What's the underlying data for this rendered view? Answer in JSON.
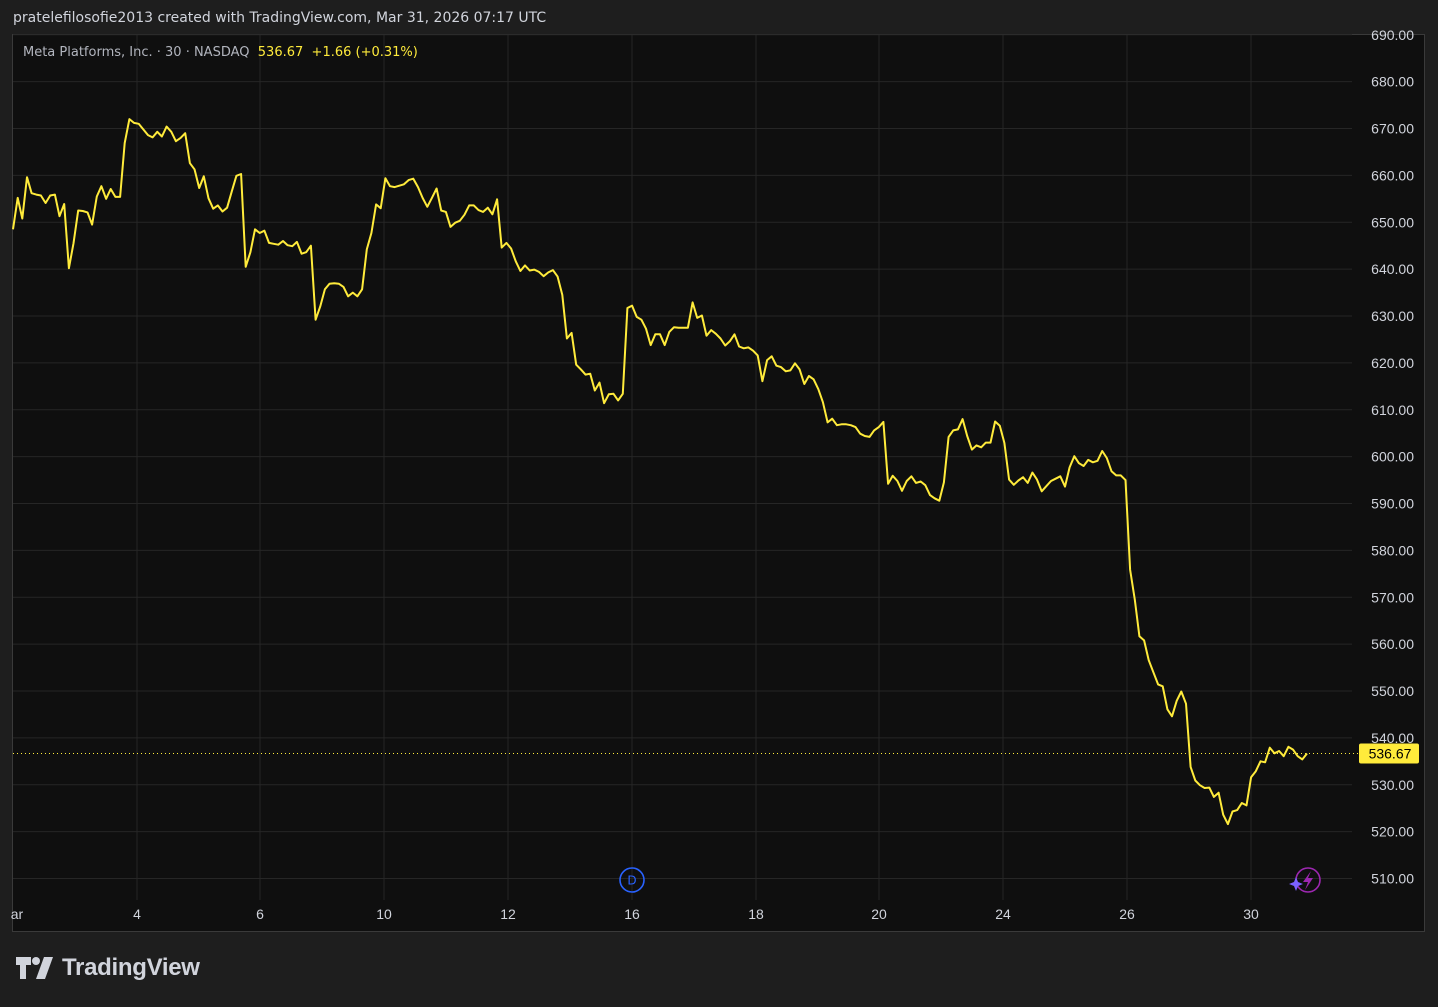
{
  "header": {
    "attribution": "pratelefilosofie2013 created with TradingView.com, Mar 31, 2026 07:17 UTC"
  },
  "legend": {
    "symbol": "Meta Platforms, Inc. · 30 · NASDAQ",
    "last": "536.67",
    "change": "+1.66 (+0.31%)"
  },
  "brand": {
    "name": "TradingView",
    "icon": "tradingview-logo-icon"
  },
  "markers": {
    "dividend": "D",
    "lightning": "lightning-icon"
  },
  "colors": {
    "line": "#ffeb3b",
    "background": "#0f0f0f",
    "grid": "#262626",
    "axis_text": "#d1d4dc",
    "price_tag_bg": "#ffeb3b",
    "dividend_marker": "#2962ff",
    "lightning_marker": "#9c27b0"
  },
  "chart_data": {
    "type": "line",
    "title": "Meta Platforms, Inc. · 30 · NASDAQ",
    "series": [
      {
        "name": "Meta Platforms, Inc.",
        "values": [
          648.5,
          655.2,
          650.8,
          659.6,
          656.2,
          655.9,
          655.7,
          654.1,
          655.7,
          655.9,
          651.3,
          653.9,
          640.2,
          645.5,
          652.5,
          652.4,
          652.1,
          649.5,
          655.5,
          657.7,
          655.0,
          657.1,
          655.4,
          655.4,
          666.9,
          672.0,
          671.2,
          671.0,
          669.8,
          668.6,
          668.1,
          669.3,
          668.3,
          670.4,
          669.3,
          667.3,
          668.0,
          669.0,
          662.6,
          661.3,
          657.3,
          659.8,
          655.1,
          652.9,
          653.6,
          652.3,
          653.1,
          656.6,
          659.9,
          660.3,
          640.5,
          643.6,
          648.5,
          647.7,
          648.2,
          645.6,
          645.4,
          645.2,
          646.0,
          645.1,
          644.9,
          645.8,
          643.3,
          643.6,
          645.0,
          629.2,
          632.0,
          635.7,
          636.9,
          637.0,
          636.9,
          636.2,
          634.2,
          635.0,
          634.2,
          635.7,
          644.2,
          647.7,
          653.8,
          653.0,
          659.4,
          657.7,
          657.5,
          657.8,
          658.1,
          659.0,
          659.3,
          657.5,
          655.2,
          653.3,
          655.2,
          657.2,
          652.5,
          652.2,
          649.0,
          649.9,
          650.3,
          651.6,
          653.6,
          653.6,
          652.6,
          652.2,
          653.1,
          651.7,
          654.9,
          644.6,
          645.6,
          644.4,
          641.7,
          639.6,
          640.8,
          639.7,
          639.9,
          639.4,
          638.5,
          639.3,
          639.8,
          638.4,
          634.5,
          625.2,
          626.4,
          619.6,
          618.6,
          617.5,
          617.7,
          614.1,
          615.8,
          611.4,
          613.3,
          613.4,
          612.0,
          613.4,
          631.7,
          632.2,
          629.8,
          629.2,
          627.3,
          623.8,
          626.1,
          626.1,
          623.8,
          626.6,
          627.6,
          627.5,
          627.5,
          627.5,
          632.9,
          629.6,
          630.1,
          625.8,
          627.0,
          626.2,
          625.2,
          623.7,
          624.6,
          626.1,
          623.5,
          623.1,
          623.3,
          622.6,
          621.6,
          616.1,
          620.6,
          621.4,
          619.4,
          619.1,
          618.2,
          618.4,
          619.9,
          618.6,
          615.5,
          617.2,
          616.5,
          614.4,
          611.6,
          607.3,
          608.1,
          606.7,
          606.9,
          606.9,
          606.7,
          606.3,
          604.9,
          604.4,
          604.2,
          605.6,
          606.3,
          607.4,
          594.2,
          595.9,
          594.8,
          592.7,
          594.8,
          595.8,
          594.4,
          594.7,
          593.9,
          591.8,
          591.1,
          590.6,
          594.5,
          604.2,
          605.6,
          605.8,
          608.0,
          604.4,
          601.5,
          602.4,
          602.0,
          603.0,
          603.0,
          607.5,
          606.6,
          602.9,
          595.1,
          594.0,
          594.9,
          595.6,
          594.4,
          596.6,
          595.1,
          592.6,
          593.7,
          594.8,
          595.3,
          595.8,
          593.6,
          597.7,
          600.1,
          598.6,
          598.0,
          599.3,
          598.8,
          599.1,
          601.2,
          599.7,
          596.9,
          596.0,
          596.0,
          595.0,
          575.9,
          569.5,
          561.7,
          560.8,
          556.6,
          554.0,
          551.4,
          551.0,
          546.1,
          544.6,
          547.9,
          549.9,
          547.3,
          533.8,
          530.9,
          529.9,
          529.3,
          529.4,
          527.4,
          528.3,
          523.6,
          521.6,
          524.3,
          524.6,
          526.1,
          525.6,
          531.6,
          532.9,
          535.0,
          534.8,
          537.9,
          536.7,
          537.2,
          536.1,
          538.1,
          537.5,
          536.1,
          535.4,
          536.67
        ]
      }
    ],
    "x_ticks": [
      "ar",
      "4",
      "6",
      "10",
      "12",
      "16",
      "18",
      "20",
      "24",
      "26",
      "30"
    ],
    "y_ticks": [
      "510.00",
      "520.00",
      "530.00",
      "540.00",
      "550.00",
      "560.00",
      "570.00",
      "580.00",
      "590.00",
      "600.00",
      "610.00",
      "620.00",
      "630.00",
      "640.00",
      "650.00",
      "660.00",
      "670.00",
      "680.00",
      "690.00"
    ],
    "ylim": [
      506.1,
      691.2
    ],
    "last_price_label": "536.67",
    "grid": true
  }
}
